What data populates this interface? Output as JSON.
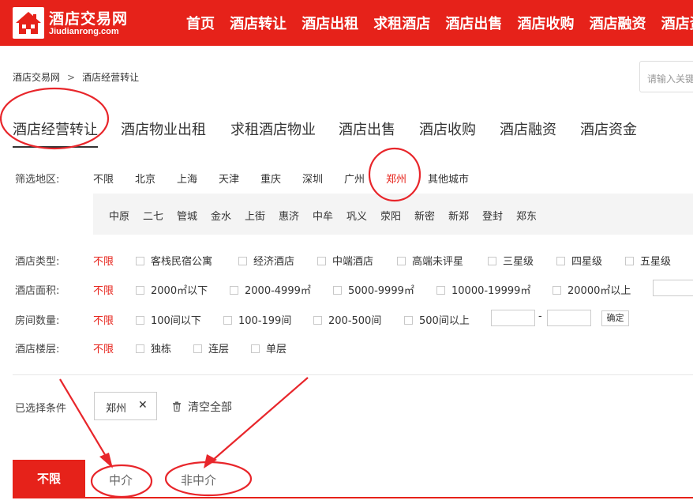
{
  "header": {
    "logo_text": "酒店交易网",
    "logo_sub": "Jiudianrong.com",
    "nav": [
      "首页",
      "酒店转让",
      "酒店出租",
      "求租酒店",
      "酒店出售",
      "酒店收购",
      "酒店融资",
      "酒店资金"
    ]
  },
  "breadcrumb": {
    "home": "酒店交易网",
    "sep": ">",
    "current": "酒店经营转让"
  },
  "search": {
    "placeholder": "请输入关键"
  },
  "tabs": [
    "酒店经营转让",
    "酒店物业出租",
    "求租酒店物业",
    "酒店出售",
    "酒店收购",
    "酒店融资",
    "酒店资金"
  ],
  "filters": {
    "region": {
      "label": "筛选地区:",
      "options": [
        "不限",
        "北京",
        "上海",
        "天津",
        "重庆",
        "深圳",
        "广州",
        "郑州",
        "其他城市"
      ],
      "selected": "郑州",
      "districts": [
        "中原",
        "二七",
        "管城",
        "金水",
        "上街",
        "惠济",
        "中牟",
        "巩义",
        "荥阳",
        "新密",
        "新郑",
        "登封",
        "郑东"
      ]
    },
    "hotel_type": {
      "label": "酒店类型:",
      "any": "不限",
      "options": [
        "客栈民宿公寓",
        "经济酒店",
        "中端酒店",
        "高端未评星",
        "三星级",
        "四星级",
        "五星级"
      ]
    },
    "area": {
      "label": "酒店面积:",
      "any": "不限",
      "options": [
        "2000㎡以下",
        "2000-4999㎡",
        "5000-9999㎡",
        "10000-19999㎡",
        "20000㎡以上"
      ]
    },
    "rooms": {
      "label": "房间数量:",
      "any": "不限",
      "options": [
        "100间以下",
        "100-199间",
        "200-500间",
        "500间以上"
      ],
      "dash": "-",
      "confirm": "确定"
    },
    "floors": {
      "label": "酒店楼层:",
      "any": "不限",
      "options": [
        "独栋",
        "连层",
        "单层"
      ]
    }
  },
  "selected": {
    "label": "已选择条件",
    "tag": "郑州",
    "remove": "✕",
    "clear": "清空全部"
  },
  "bottom_tabs": [
    "不限",
    "中介",
    "非中介"
  ],
  "colors": {
    "brand_red": "#e6221a",
    "annotation_red": "#e8262b"
  },
  "icons": {
    "logo": "building-icon",
    "trash": "trash-icon"
  }
}
